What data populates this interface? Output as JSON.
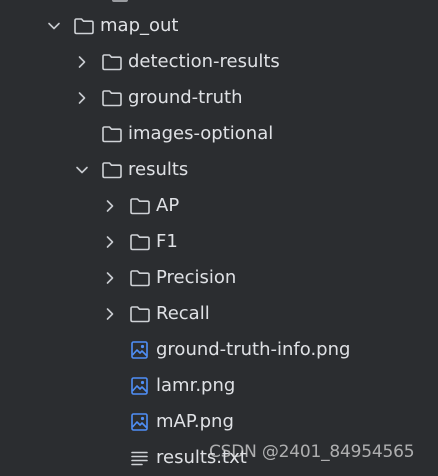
{
  "tree": {
    "items": [
      {
        "label": "map_out",
        "type": "folder",
        "expanded": true,
        "depth": 0
      },
      {
        "label": "detection-results",
        "type": "folder",
        "expanded": false,
        "depth": 1
      },
      {
        "label": "ground-truth",
        "type": "folder",
        "expanded": false,
        "depth": 1
      },
      {
        "label": "images-optional",
        "type": "folder",
        "expanded": null,
        "depth": 1
      },
      {
        "label": "results",
        "type": "folder",
        "expanded": true,
        "depth": 1
      },
      {
        "label": "AP",
        "type": "folder",
        "expanded": false,
        "depth": 2
      },
      {
        "label": "F1",
        "type": "folder",
        "expanded": false,
        "depth": 2
      },
      {
        "label": "Precision",
        "type": "folder",
        "expanded": false,
        "depth": 2
      },
      {
        "label": "Recall",
        "type": "folder",
        "expanded": false,
        "depth": 2
      },
      {
        "label": "ground-truth-info.png",
        "type": "image",
        "depth": 2
      },
      {
        "label": "lamr.png",
        "type": "image",
        "depth": 2
      },
      {
        "label": "mAP.png",
        "type": "image",
        "depth": 2
      },
      {
        "label": "results.txt",
        "type": "text",
        "depth": 2
      }
    ]
  },
  "watermark": {
    "text": "CSDN @2401_84954565"
  },
  "colors": {
    "background": "#2b2d30",
    "text": "#dfe1e5",
    "icon_stroke": "#cfd2d6",
    "image_icon": "#4f8ff7",
    "chevron": "#c8cbd0"
  },
  "icons": {
    "folder": "folder-icon",
    "image": "image-file-icon",
    "text": "text-file-icon",
    "expanded": "chevron-down-icon",
    "collapsed": "chevron-right-icon"
  }
}
